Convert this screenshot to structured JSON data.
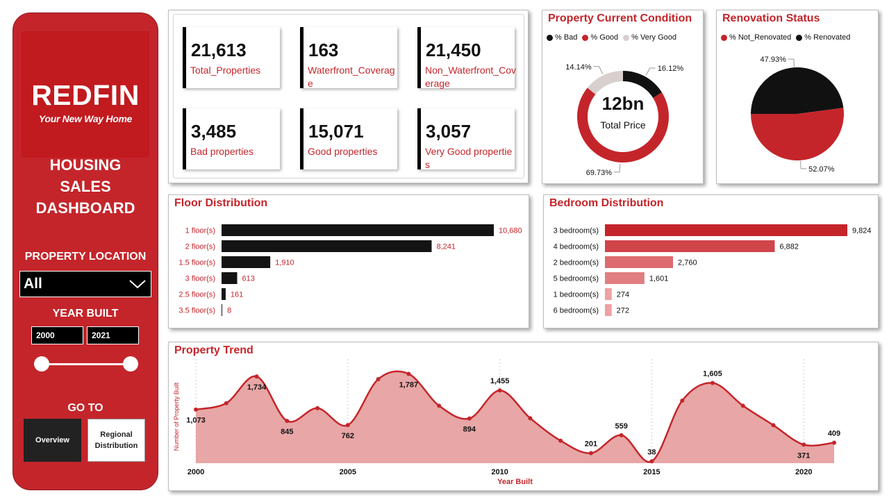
{
  "sidebar": {
    "logo": {
      "brand": "REDFIN",
      "tagline": "Your New Way Home"
    },
    "title_lines": [
      "HOUSING",
      "SALES",
      "DASHBOARD"
    ],
    "location_label": "PROPERTY LOCATION",
    "location_value": "All",
    "year_label": "YEAR BUILT",
    "year_from": "2000",
    "year_to": "2021",
    "goto_label": "GO TO",
    "nav": [
      {
        "label": "Overview"
      },
      {
        "label": "Regional Distribution"
      }
    ]
  },
  "kpis": [
    {
      "value": "21,613",
      "label": "Total_Properties"
    },
    {
      "value": "163",
      "label": "Waterfront_Coverage"
    },
    {
      "value": "21,450",
      "label": "Non_Waterfront_Coverage"
    },
    {
      "value": "3,485",
      "label": "Bad properties"
    },
    {
      "value": "15,071",
      "label": "Good properties"
    },
    {
      "value": "3,057",
      "label": "Very Good properties"
    }
  ],
  "colors": {
    "red": "#c4252a",
    "black": "#111111",
    "light_gray": "#d9cfcf",
    "pink": "#e8a6a6"
  },
  "chart_data": [
    {
      "id": "condition",
      "type": "donut",
      "title": "Property Current Condition",
      "center_value": "12bn",
      "center_label": "Total Price",
      "legend": [
        "% Bad",
        "% Good",
        "% Very Good"
      ],
      "slices": [
        {
          "name": "% Bad",
          "value": 16.12,
          "label": "16.12%",
          "color": "#111111"
        },
        {
          "name": "% Good",
          "value": 69.73,
          "label": "69.73%",
          "color": "#c4252a"
        },
        {
          "name": "% Very Good",
          "value": 14.14,
          "label": "14.14%",
          "color": "#d9cfcf"
        }
      ]
    },
    {
      "id": "renovation",
      "type": "pie",
      "title": "Renovation Status",
      "legend": [
        "% Not_Renovated",
        "% Renovated"
      ],
      "slices": [
        {
          "name": "% Renovated",
          "value": 47.93,
          "label": "47.93%",
          "color": "#111111"
        },
        {
          "name": "% Not_Renovated",
          "value": 52.07,
          "label": "52.07%",
          "color": "#c4252a"
        }
      ]
    },
    {
      "id": "floors",
      "type": "bar",
      "orientation": "horizontal",
      "title": "Floor Distribution",
      "categories": [
        "1 floor(s)",
        "2 floor(s)",
        "1.5 floor(s)",
        "3 floor(s)",
        "2.5 floor(s)",
        "3.5 floor(s)"
      ],
      "values": [
        10680,
        8241,
        1910,
        613,
        161,
        8
      ],
      "labels": [
        "10,680",
        "8,241",
        "1,910",
        "613",
        "161",
        "8"
      ],
      "max": 10680
    },
    {
      "id": "bedrooms",
      "type": "bar",
      "orientation": "horizontal",
      "title": "Bedroom Distribution",
      "categories": [
        "3 bedroom(s)",
        "4 bedroom(s)",
        "2 bedroom(s)",
        "5 bedroom(s)",
        "1 bedroom(s)",
        "6 bedroom(s)"
      ],
      "values": [
        9824,
        6882,
        2760,
        1601,
        274,
        272
      ],
      "labels": [
        "9,824",
        "6,882",
        "2,760",
        "1,601",
        "274",
        "272"
      ],
      "colors": [
        "#c4252a",
        "#d0454a",
        "#dc6b6f",
        "#e07e81",
        "#eea1a3",
        "#eea1a3"
      ],
      "max": 9824
    },
    {
      "id": "trend",
      "type": "area",
      "title": "Property Trend",
      "xlabel": "Year Built",
      "ylabel": "Number of Property Built",
      "x": [
        2000,
        2001,
        2002,
        2003,
        2004,
        2005,
        2006,
        2007,
        2008,
        2009,
        2010,
        2011,
        2012,
        2013,
        2014,
        2015,
        2016,
        2017,
        2018,
        2019,
        2020,
        2021
      ],
      "y": [
        1073,
        1200,
        1734,
        845,
        1100,
        762,
        1680,
        1787,
        1150,
        894,
        1455,
        900,
        450,
        201,
        559,
        38,
        1250,
        1605,
        1150,
        760,
        371,
        409
      ],
      "data_labels": [
        {
          "year": 2000,
          "label": "1,073",
          "pos": "below"
        },
        {
          "year": 2002,
          "label": "1,734",
          "pos": "below"
        },
        {
          "year": 2003,
          "label": "845",
          "pos": "below"
        },
        {
          "year": 2005,
          "label": "762",
          "pos": "below"
        },
        {
          "year": 2007,
          "label": "1,787",
          "pos": "below"
        },
        {
          "year": 2009,
          "label": "894",
          "pos": "below"
        },
        {
          "year": 2010,
          "label": "1,455",
          "pos": "above"
        },
        {
          "year": 2013,
          "label": "201",
          "pos": "above"
        },
        {
          "year": 2014,
          "label": "559",
          "pos": "above"
        },
        {
          "year": 2015,
          "label": "38",
          "pos": "above"
        },
        {
          "year": 2017,
          "label": "1,605",
          "pos": "above"
        },
        {
          "year": 2020,
          "label": "371",
          "pos": "below"
        },
        {
          "year": 2021,
          "label": "409",
          "pos": "above"
        }
      ],
      "xticks": [
        2000,
        2005,
        2010,
        2015,
        2020
      ],
      "ylim": [
        0,
        2000
      ]
    }
  ]
}
